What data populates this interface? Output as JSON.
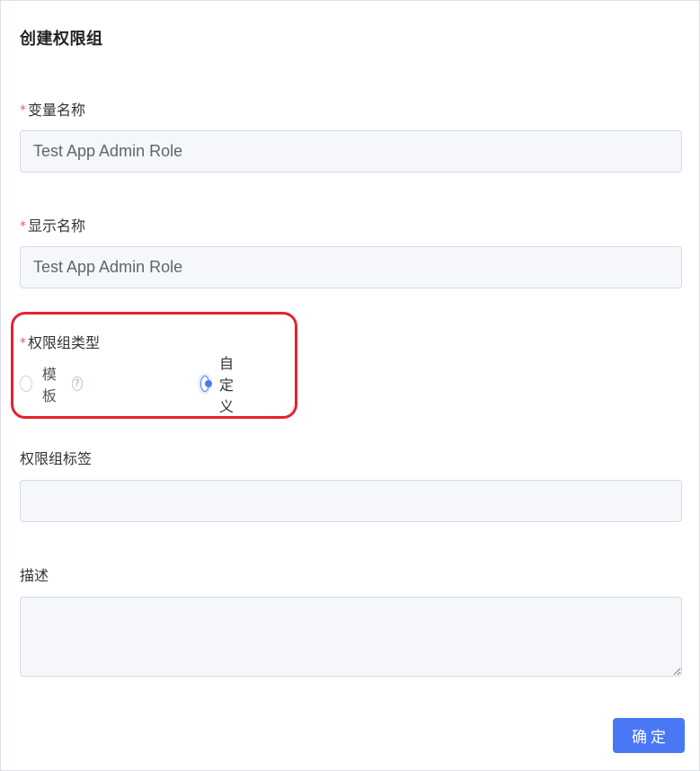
{
  "dialog": {
    "title": "创建权限组"
  },
  "fields": {
    "var_name": {
      "required_mark": "*",
      "label": "变量名称",
      "value": "Test App Admin Role"
    },
    "display_name": {
      "required_mark": "*",
      "label": "显示名称",
      "value": "Test App Admin Role"
    },
    "group_type": {
      "required_mark": "*",
      "label": "权限组类型",
      "options": [
        {
          "label": "模板",
          "selected": false,
          "help_icon": "question-circle-icon"
        },
        {
          "label": "自定义",
          "selected": true
        }
      ],
      "help_glyph": "?"
    },
    "group_tags": {
      "label": "权限组标签",
      "value": ""
    },
    "description": {
      "label": "描述",
      "value": ""
    }
  },
  "actions": {
    "confirm_label": "确定"
  },
  "colors": {
    "primary": "#4a78f5",
    "required": "#f05a5a",
    "highlight": "#e4232f"
  }
}
